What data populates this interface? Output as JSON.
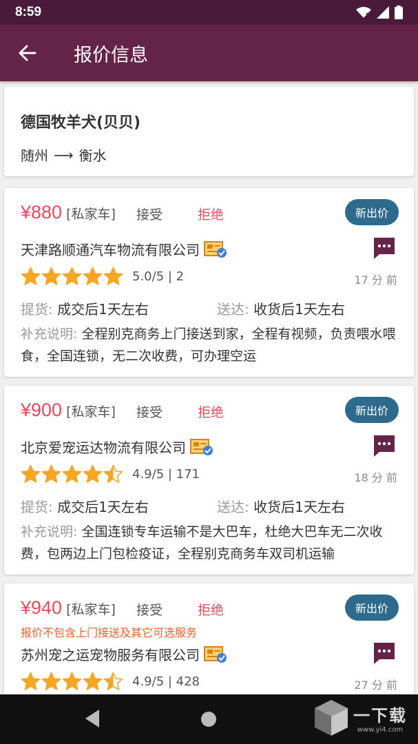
{
  "status_bar": {
    "time": "8:59"
  },
  "app_bar": {
    "title": "报价信息"
  },
  "pet": {
    "name": "德国牧羊犬(贝贝)",
    "from": "随州",
    "to": "衡水",
    "arrow": "⟶"
  },
  "labels": {
    "accept": "接受",
    "reject": "拒绝",
    "new_price": "新出价",
    "pickup": "提货: ",
    "deliver": "送达: ",
    "note": "补充说明: "
  },
  "quotes": [
    {
      "price": "¥880",
      "car_type": "[私家车]",
      "company": "天津路顺通汽车物流有限公司",
      "stars": 5,
      "rating": "5.0/5 | 2",
      "time_ago": "17 分 前",
      "pickup": "成交后1天左右",
      "deliver": "收货后1天左右",
      "note": "全程别克商务上门接送到家，全程有视频，负责喂水喂食，全国连锁，无二次收费，可办理空运"
    },
    {
      "price": "¥900",
      "car_type": "[私家车]",
      "company": "北京爱宠运达物流有限公司",
      "stars": 4.5,
      "rating": "4.9/5 | 171",
      "time_ago": "18 分 前",
      "pickup": "成交后1天左右",
      "deliver": "收货后1天左右",
      "note": "全国连锁专车运输不是大巴车，杜绝大巴车无二次收费，包两边上门包检疫证，全程别克商务车双司机运输"
    },
    {
      "price": "¥940",
      "car_type": "[私家车]",
      "warning": "报价不包含上门接送及其它可选服务",
      "company": "苏州宠之运宠物服务有限公司",
      "stars": 4.5,
      "rating": "4.9/5 | 428",
      "time_ago": "27 分 前"
    }
  ],
  "watermark": {
    "big": "一下载",
    "small": "www.yi4.com"
  },
  "colors": {
    "status_bar": "#4a1a3a",
    "app_bar": "#632447",
    "price": "#e8495a",
    "new_price_button": "#2e6a8c",
    "star": "#f5a623",
    "message_icon": "#632447"
  },
  "icons": {
    "back": "arrow-left-icon",
    "message": "chat-bubble-icon",
    "verified": "verified-license-icon",
    "star": "star-icon",
    "wifi": "wifi-icon",
    "signal": "signal-icon",
    "battery": "battery-icon"
  }
}
